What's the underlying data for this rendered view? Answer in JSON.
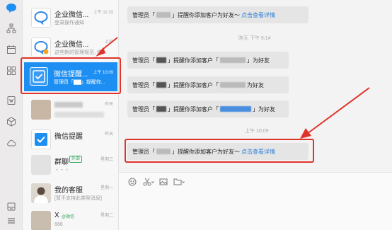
{
  "conversations": [
    {
      "title": "企业微信...",
      "time": "上午 11:33",
      "sub": "登录操作通知"
    },
    {
      "title": "企业微信...",
      "time": "上午",
      "sub": "这些新的管理规范, 你..."
    },
    {
      "title": "微信提醒...",
      "time": "上午 10:09",
      "sub": "管理员「▇▇」提醒你..."
    },
    {
      "title": "",
      "time": "昨天",
      "sub": ""
    },
    {
      "title": "微信提醒",
      "time": "昨天",
      "sub": ""
    },
    {
      "title": "群聊",
      "badge": "外部",
      "time": "星期三",
      "sub": "・・・"
    },
    {
      "title": "我的客服",
      "time": "星期一",
      "sub": "[暂不支持此类型消息]"
    },
    {
      "title": "X",
      "tag": "@微信",
      "time": "星期二",
      "sub": "666"
    }
  ],
  "messages": [
    {
      "prefix": "管理员「",
      "mid": "」提醒你添加客户为好友～",
      "link": "点击查看详情"
    },
    {
      "stamp": "昨天 下午 9:14"
    },
    {
      "prefix": "管理员「",
      "mid": "」提醒你添加客户「",
      "suffix": "」为好友"
    },
    {
      "prefix": "管理员「",
      "mid": "」提醒你添加客户「",
      "suffix": "为好友"
    },
    {
      "prefix": "管理员「",
      "mid": "」提醒你添加客户「",
      "suffix": "」为好友"
    },
    {
      "stamp": "上午 10:09"
    },
    {
      "prefix": "管理员「",
      "mid": "」提醒你添加客户为好友～",
      "link": "点击查看详情"
    }
  ],
  "colors": {
    "accent": "#1e8ff2",
    "annotation": "#e0342a",
    "link": "#2f7fd6"
  }
}
